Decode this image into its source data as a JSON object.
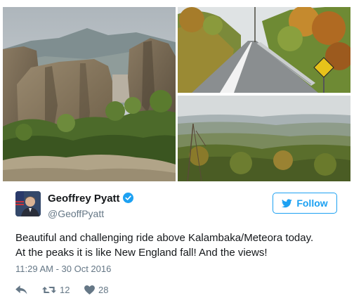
{
  "tweet": {
    "author_name": "Geoffrey Pyatt",
    "author_handle": "@GeoffPyatt",
    "follow_label": "Follow",
    "text_lines": [
      "Beautiful and challenging ride above Kalambaka/Meteora today.",
      "At the peaks it is like New England fall! And the views!"
    ],
    "timestamp": "11:29 AM - 30 Oct 2016",
    "retweet_count": "12",
    "like_count": "28"
  },
  "icons": {
    "verified": "verified-badge-icon",
    "follow_bird": "twitter-bird-icon",
    "reply": "reply-icon",
    "retweet": "retweet-icon",
    "like": "heart-icon"
  },
  "colors": {
    "accent": "#1da1f2",
    "secondary_text": "#657786",
    "primary_text": "#14171a"
  }
}
